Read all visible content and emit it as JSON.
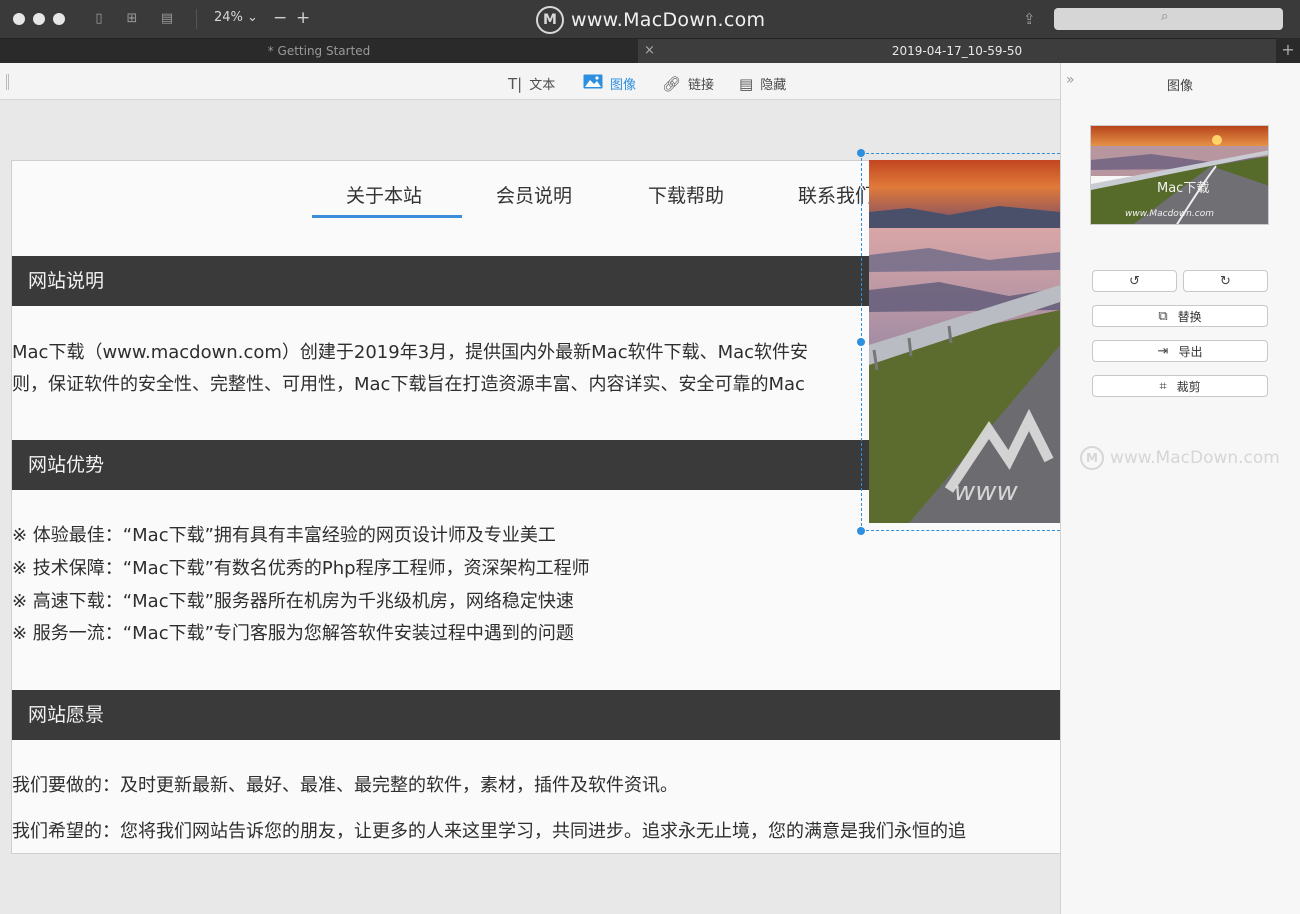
{
  "window": {
    "zoom": "24%",
    "zoom_out": "−",
    "zoom_in": "+",
    "title": "www.MacDown.com",
    "logo_letter": "M"
  },
  "tabs": [
    {
      "label": "* Getting Started"
    },
    {
      "label": "2019-04-17_10-59-50"
    }
  ],
  "tab_close": "×",
  "tab_add": "+",
  "toolbar": {
    "items": [
      {
        "label": "文本",
        "icon": "text-icon"
      },
      {
        "label": "图像",
        "icon": "image-icon",
        "active": true
      },
      {
        "label": "链接",
        "icon": "link-icon"
      },
      {
        "label": "隐藏",
        "icon": "hide-icon"
      }
    ]
  },
  "page": {
    "nav": [
      "关于本站",
      "会员说明",
      "下载帮助",
      "联系我们"
    ],
    "sections": [
      {
        "heading": "网站说明",
        "lines": [
          "Mac下载（www.macdown.com）创建于2019年3月，提供国内外最新Mac软件下载、Mac软件安",
          "则，保证软件的安全性、完整性、可用性，Mac下载旨在打造资源丰富、内容详实、安全可靠的Mac"
        ]
      },
      {
        "heading": "网站优势",
        "lines": [
          "※ 体验最佳：“Mac下载”拥有具有丰富经验的网页设计师及专业美工",
          "※ 技术保障：“Mac下载”有数名优秀的Php程序工程师，资深架构工程师",
          "※ 高速下载：“Mac下载”服务器所在机房为千兆级机房，网络稳定快速",
          "※ 服务一流：“Mac下载”专门客服为您解答软件安装过程中遇到的问题"
        ]
      },
      {
        "heading": "网站愿景",
        "lines": [
          "我们要做的：及时更新最新、最好、最准、最完整的软件，素材，插件及软件资讯。",
          "我们希望的：您将我们网站告诉您的朋友，让更多的人来这里学习，共同进步。追求永无止境，您的满意是我们永恒的追"
        ]
      }
    ]
  },
  "panel": {
    "title": "图像",
    "collapse": "»",
    "thumb_brand": "Mac下载",
    "thumb_url": "www.Macdown.com",
    "rotate_left": "↺",
    "rotate_right": "↻",
    "replace": "替换",
    "export": "导出",
    "crop": "裁剪",
    "watermark": "www.MacDown.com"
  },
  "colors": {
    "accent": "#2d8fe0",
    "titlebar": "#3a3a3a",
    "section_bar": "#3a3a3a"
  }
}
